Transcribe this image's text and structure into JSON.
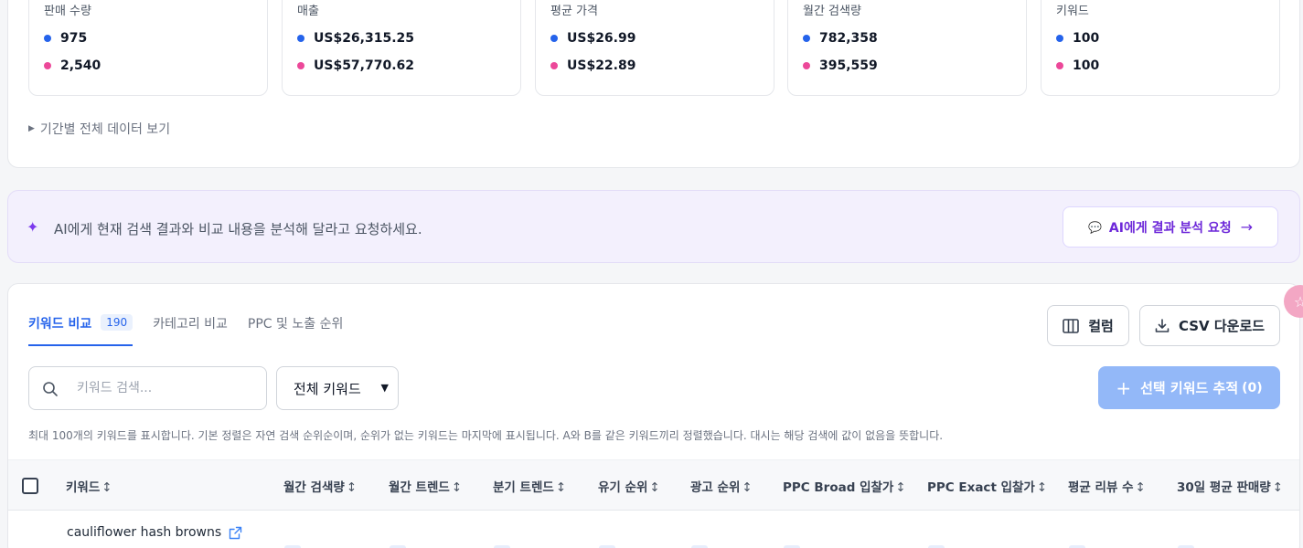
{
  "metrics": [
    {
      "title": "판매 수량",
      "a": "975",
      "b": "2,540"
    },
    {
      "title": "매출",
      "a": "US$26,315.25",
      "b": "US$57,770.62"
    },
    {
      "title": "평균 가격",
      "a": "US$26.99",
      "b": "US$22.89"
    },
    {
      "title": "월간 검색량",
      "a": "782,358",
      "b": "395,559"
    },
    {
      "title": "키워드",
      "a": "100",
      "b": "100"
    }
  ],
  "expand_label": "기간별 전체 데이터 보기",
  "ai_banner": {
    "text": "AI에게 현재 검색 결과와 비교 내용을 분석해 달라고 요청하세요.",
    "button_label": "AI에게 결과 분석 요청"
  },
  "tabs": [
    {
      "label": "키워드 비교",
      "count": "190"
    },
    {
      "label": "카테고리 비교"
    },
    {
      "label": "PPC 및 노출 순위"
    }
  ],
  "toolbar": {
    "columns_label": "컬럼",
    "csv_label": "CSV 다운로드",
    "search_placeholder": "키워드 검색...",
    "filter_value": "전체 키워드",
    "track_label": "선택 키워드 추적",
    "track_count": "(0)"
  },
  "hint": "최대 100개의 키워드를 표시합니다. 기본 정렬은 자연 검색 순위순이며, 순위가 없는 키워드는 마지막에 표시됩니다. A와 B를 같은 키워드끼리 정렬했습니다. 대시는 해당 검색에 값이 없음을 뜻합니다.",
  "table": {
    "headers": [
      "키워드",
      "월간 검색량",
      "월간 트렌드",
      "분기 트렌드",
      "유기 순위",
      "광고 순위",
      "PPC Broad 입찰가",
      "PPC Exact 입찰가",
      "평균 리뷰 수",
      "30일 평균 판매량"
    ],
    "sort_glyph": "↕",
    "rows": [
      {
        "keyword": "cauliflower hash browns"
      }
    ]
  },
  "colors": {
    "series_a": "#2563eb",
    "series_b": "#ec4899",
    "accent": "#2563eb",
    "ai": "#6d28d9"
  }
}
